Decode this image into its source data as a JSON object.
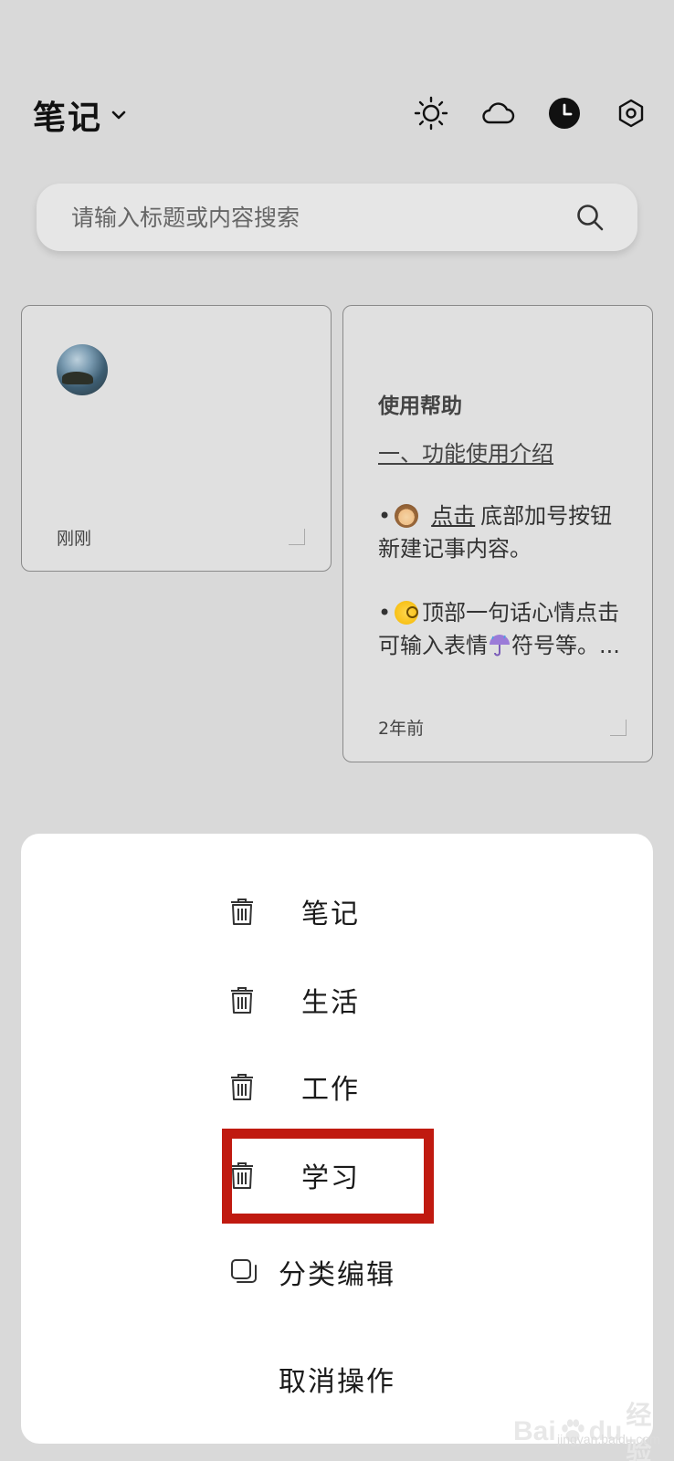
{
  "header": {
    "title": "笔记",
    "icons": [
      "sun-icon",
      "cloud-icon",
      "clock-icon",
      "settings-icon"
    ]
  },
  "search": {
    "placeholder": "请输入标题或内容搜索"
  },
  "notes": [
    {
      "time": "刚刚"
    },
    {
      "title": "使用帮助",
      "subtitle": "一、功能使用介绍",
      "para1_link": "点击",
      "para1_text": "底部加号按钮 新建记事内容。",
      "para2_text": "顶部一句话心情点击可输入表情",
      "para2_tail": "符号等。...",
      "time": "2年前"
    }
  ],
  "menu": {
    "items": [
      {
        "label": "笔记"
      },
      {
        "label": "生活"
      },
      {
        "label": "工作"
      },
      {
        "label": "学习"
      },
      {
        "label": "分类编辑"
      }
    ],
    "cancel_label": "取消操作",
    "highlighted_item": "学习",
    "highlight_color": "#c01a10"
  },
  "watermark": {
    "brand": "Bai",
    "brand2": "du",
    "product": "经验",
    "url": "jingyan.baidu.com"
  }
}
